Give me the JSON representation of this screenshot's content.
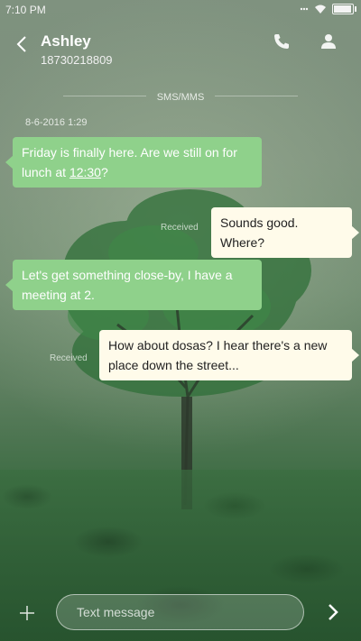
{
  "status_bar": {
    "time": "7:10 PM",
    "icons": [
      "dots-icon",
      "wifi-icon",
      "battery-icon"
    ]
  },
  "header": {
    "contact_name": "Ashley",
    "contact_number": "18730218809",
    "icons": [
      "back-icon",
      "phone-icon",
      "person-icon"
    ]
  },
  "conversation": {
    "service_label": "SMS/MMS",
    "date": "8-6-2016 1:29",
    "messages": [
      {
        "type": "sent",
        "text_before_link": "Friday is finally here. Are we still on for lunch at ",
        "link": "12:30",
        "text_after_link": "?"
      },
      {
        "type": "received",
        "status": "Received",
        "text": "Sounds good. Where?"
      },
      {
        "type": "sent",
        "text": "Let's get something close-by, I have a meeting at 2."
      },
      {
        "type": "received",
        "status": "Received",
        "text": "How about dosas? I hear there's a new place down the street..."
      }
    ]
  },
  "composer": {
    "placeholder": "Text message",
    "icons": [
      "plus-icon",
      "send-icon"
    ]
  },
  "colors": {
    "sent_bubble": "#8fd18b",
    "received_bubble": "#fffbea"
  }
}
